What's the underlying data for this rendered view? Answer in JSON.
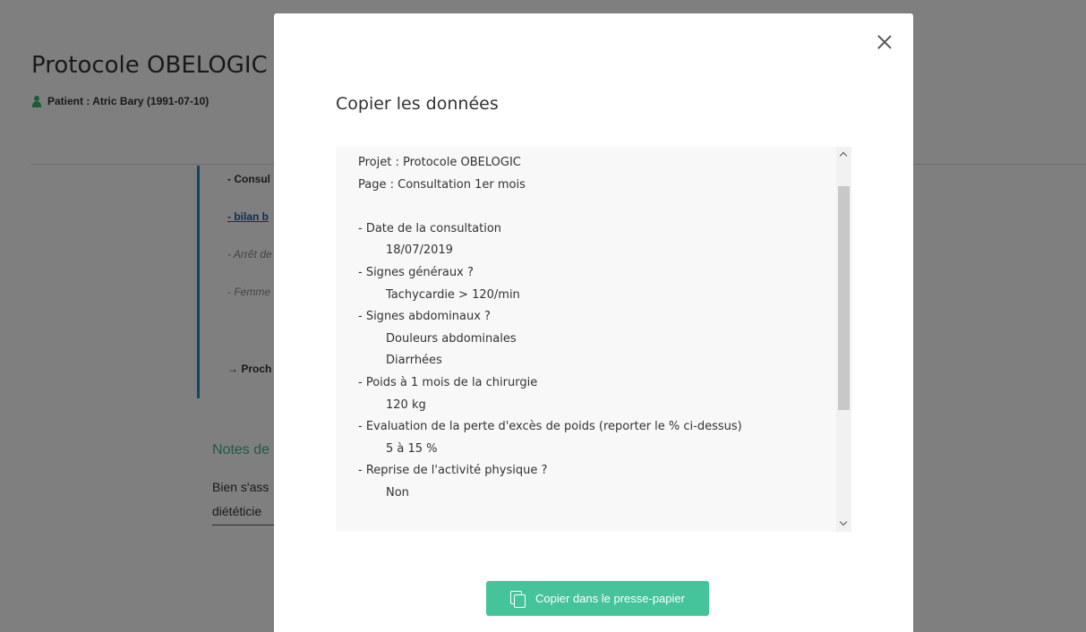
{
  "background": {
    "title": "Protocole OBELOGIC",
    "patient": "Patient : Atric Bary (1991-07-10)",
    "lines": [
      "- Consul",
      "- bilan b",
      "- Arrêt de",
      "- Femme",
      "→ Proch"
    ],
    "notes_title": "Notes de",
    "notes_lines": [
      "Bien s'ass",
      "diététicie"
    ]
  },
  "modal": {
    "title": "Copier les données",
    "rows": [
      {
        "text": "Projet : Protocole OBELOGIC",
        "indent": false
      },
      {
        "text": "Page : Consultation 1er mois",
        "indent": false
      },
      {
        "text": "",
        "indent": false
      },
      {
        "text": "- Date de la consultation",
        "indent": false
      },
      {
        "text": "18/07/2019",
        "indent": true
      },
      {
        "text": "- Signes généraux ?",
        "indent": false
      },
      {
        "text": "Tachycardie > 120/min",
        "indent": true
      },
      {
        "text": "- Signes abdominaux ?",
        "indent": false
      },
      {
        "text": "Douleurs abdominales",
        "indent": true
      },
      {
        "text": "Diarrhées",
        "indent": true
      },
      {
        "text": "- Poids à 1 mois de la chirurgie",
        "indent": false
      },
      {
        "text": "120 kg",
        "indent": true
      },
      {
        "text": "- Evaluation de la perte d'excès de poids (reporter le % ci-dessus)",
        "indent": false
      },
      {
        "text": "5 à 15 %",
        "indent": true
      },
      {
        "text": "- Reprise de l'activité physique ?",
        "indent": false
      },
      {
        "text": "Non",
        "indent": true
      }
    ],
    "copy_button_label": "Copier dans le presse-papier"
  },
  "colors": {
    "accent_green": "#45c39b",
    "overlay": "rgba(0,0,0,0.5)",
    "link_blue": "#1e5fa8",
    "card_border": "#1e90c8"
  }
}
